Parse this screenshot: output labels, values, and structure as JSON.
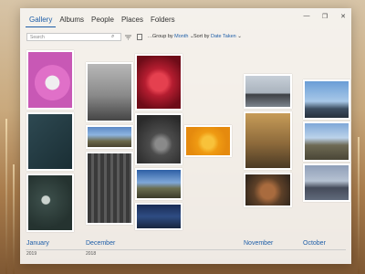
{
  "tabs": [
    {
      "label": "Gallery",
      "active": true
    },
    {
      "label": "Albums"
    },
    {
      "label": "People"
    },
    {
      "label": "Places"
    },
    {
      "label": "Folders"
    }
  ],
  "window_controls": {
    "minimize": "—",
    "maximize": "❐",
    "close": "✕"
  },
  "toolbar": {
    "search_placeholder": "Search",
    "group_prefix": "Group by",
    "group_value": "Month",
    "sort_prefix": "Sort by",
    "sort_value": "Date Taken"
  },
  "timeline": [
    {
      "month": "January",
      "year": "2019"
    },
    {
      "month": "December",
      "year": "2018"
    },
    {
      "month": "November",
      "year": ""
    },
    {
      "month": "October",
      "year": ""
    }
  ],
  "colors": {
    "accent": "#1e5ea8"
  }
}
